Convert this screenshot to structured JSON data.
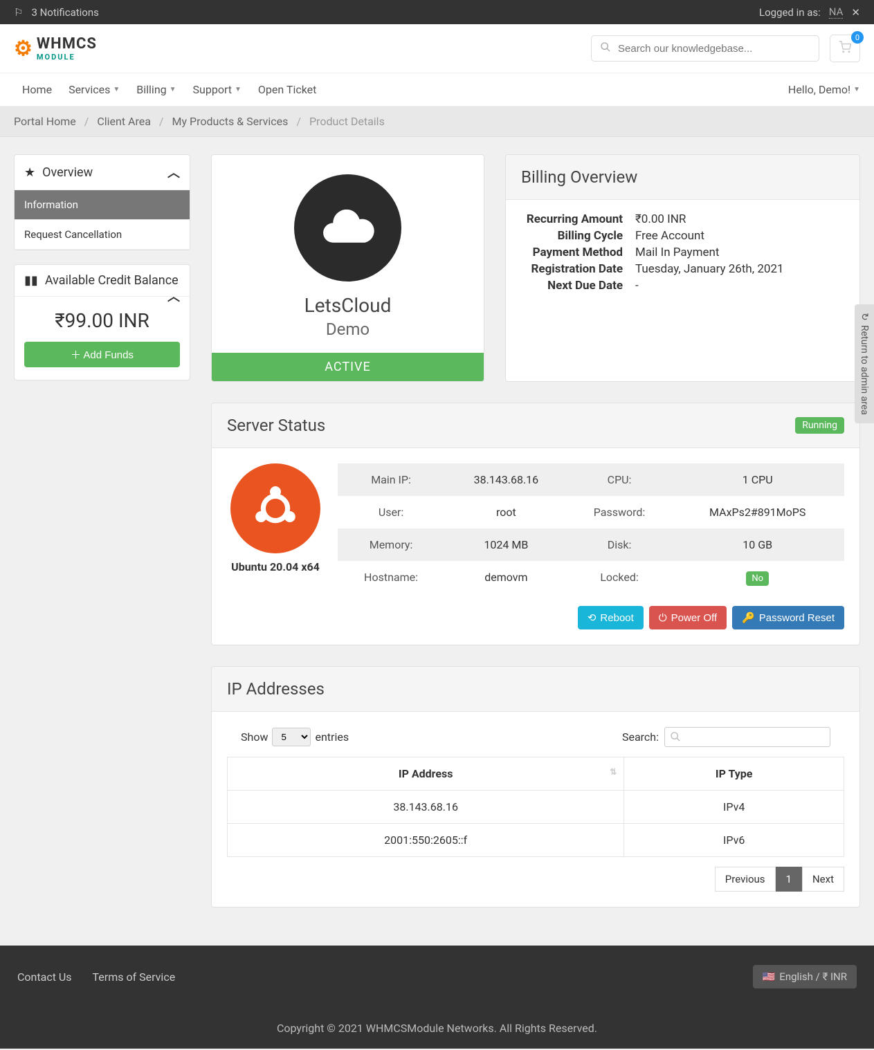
{
  "topbar": {
    "notifications": "3 Notifications",
    "logged_in_as": "Logged in as:",
    "user": "NA"
  },
  "header": {
    "logo_text1": "WHMCS",
    "logo_text2": "MODULE",
    "search_placeholder": "Search our knowledgebase...",
    "cart_count": "0"
  },
  "nav": {
    "items": [
      "Home",
      "Services",
      "Billing",
      "Support",
      "Open Ticket"
    ],
    "greeting": "Hello, Demo!"
  },
  "breadcrumb": {
    "items": [
      "Portal Home",
      "Client Area",
      "My Products & Services"
    ],
    "current": "Product Details"
  },
  "sidebar": {
    "overview": {
      "title": "Overview",
      "items": [
        "Information",
        "Request Cancellation"
      ]
    },
    "credit": {
      "title": "Available Credit Balance",
      "amount": "₹99.00 INR",
      "button": "Add Funds"
    }
  },
  "product": {
    "name": "LetsCloud",
    "group": "Demo",
    "status": "ACTIVE"
  },
  "billing": {
    "title": "Billing Overview",
    "rows": [
      {
        "label": "Recurring Amount",
        "value": "₹0.00 INR"
      },
      {
        "label": "Billing Cycle",
        "value": "Free Account"
      },
      {
        "label": "Payment Method",
        "value": "Mail In Payment"
      },
      {
        "label": "Registration Date",
        "value": "Tuesday, January 26th, 2021"
      },
      {
        "label": "Next Due Date",
        "value": "-"
      }
    ]
  },
  "server": {
    "title": "Server Status",
    "badge": "Running",
    "os": "Ubuntu 20.04 x64",
    "info": {
      "main_ip_label": "Main IP:",
      "main_ip": "38.143.68.16",
      "cpu_label": "CPU:",
      "cpu": "1 CPU",
      "user_label": "User:",
      "user": "root",
      "password_label": "Password:",
      "password": "MAxPs2#891MoPS",
      "memory_label": "Memory:",
      "memory": "1024 MB",
      "disk_label": "Disk:",
      "disk": "10 GB",
      "hostname_label": "Hostname:",
      "hostname": "demovm",
      "locked_label": "Locked:",
      "locked": "No"
    },
    "actions": {
      "reboot": "Reboot",
      "poweroff": "Power Off",
      "pwreset": "Password Reset"
    }
  },
  "ip": {
    "title": "IP Addresses",
    "show_label": "Show",
    "entries_label": "entries",
    "per_page": "5",
    "search_label": "Search:",
    "columns": [
      "IP Address",
      "IP Type"
    ],
    "rows": [
      {
        "addr": "38.143.68.16",
        "type": "IPv4"
      },
      {
        "addr": "2001:550:2605::f",
        "type": "IPv6"
      }
    ],
    "pagination": {
      "prev": "Previous",
      "page": "1",
      "next": "Next"
    }
  },
  "footer": {
    "links": [
      "Contact Us",
      "Terms of Service"
    ],
    "lang": "English / ₹ INR",
    "copyright": "Copyright © 2021 WHMCSModule Networks. All Rights Reserved."
  },
  "side_tab": "Return to admin area"
}
